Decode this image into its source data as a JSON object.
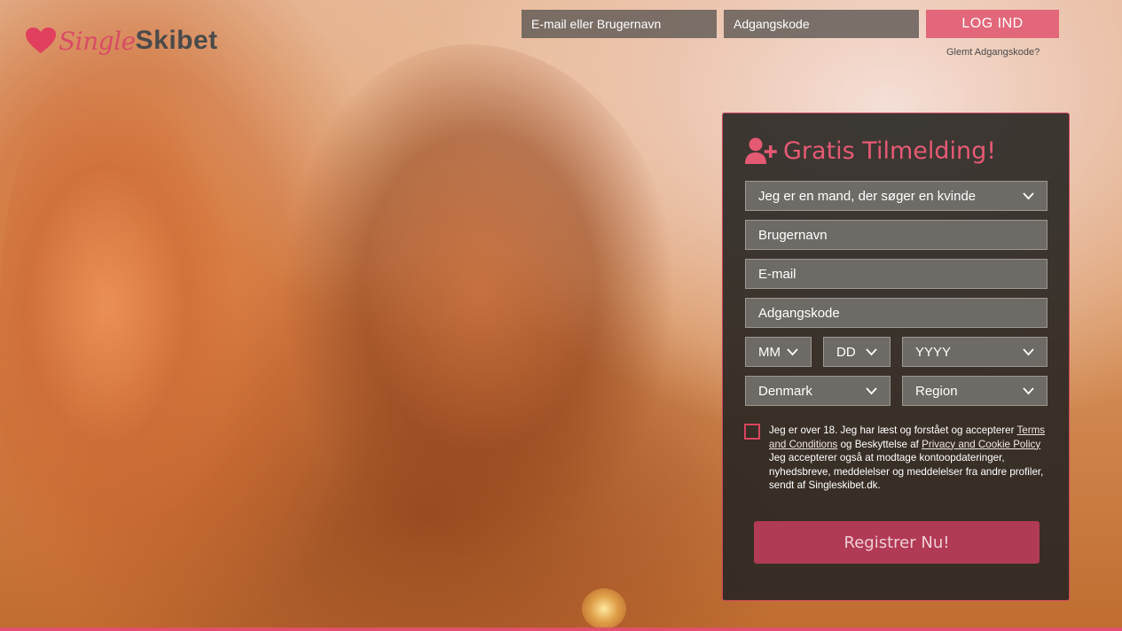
{
  "brand": {
    "logo_script": "Single",
    "logo_bold": "Skibet"
  },
  "topbar": {
    "email_placeholder": "E-mail eller Brugernavn",
    "password_placeholder": "Adgangskode",
    "login_label": "LOG IND",
    "forgot_label": "Glemt Adgangskode?"
  },
  "signup": {
    "title": "Gratis Tilmelding!",
    "seeking_value": "Jeg er en mand, der søger en kvinde",
    "username_placeholder": "Brugernavn",
    "email_placeholder": "E-mail",
    "password_placeholder": "Adgangskode",
    "month_value": "MM",
    "day_value": "DD",
    "year_value": "YYYY",
    "country_value": "Denmark",
    "region_value": "Region",
    "consent": {
      "part1": "Jeg er over 18. Jeg har læst og forstået og accepterer ",
      "terms_link": "Terms and Conditions",
      "part2": " og Beskyttelse af ",
      "privacy_link": "Privacy and Cookie Policy",
      "part3": " Jeg accepterer også at modtage kontoopdateringer, nyhedsbreve, meddelelser og meddelelser fra andre profiler, sendt af Singleskibet.dk."
    },
    "register_label": "Registrer Nu!"
  },
  "colors": {
    "accent": "#e3677a",
    "panel_bg": "#282622",
    "button": "#b13a55"
  },
  "icons": {
    "logo": "heart-icon",
    "signup": "add-user-icon",
    "dropdown": "chevron-down-icon"
  }
}
